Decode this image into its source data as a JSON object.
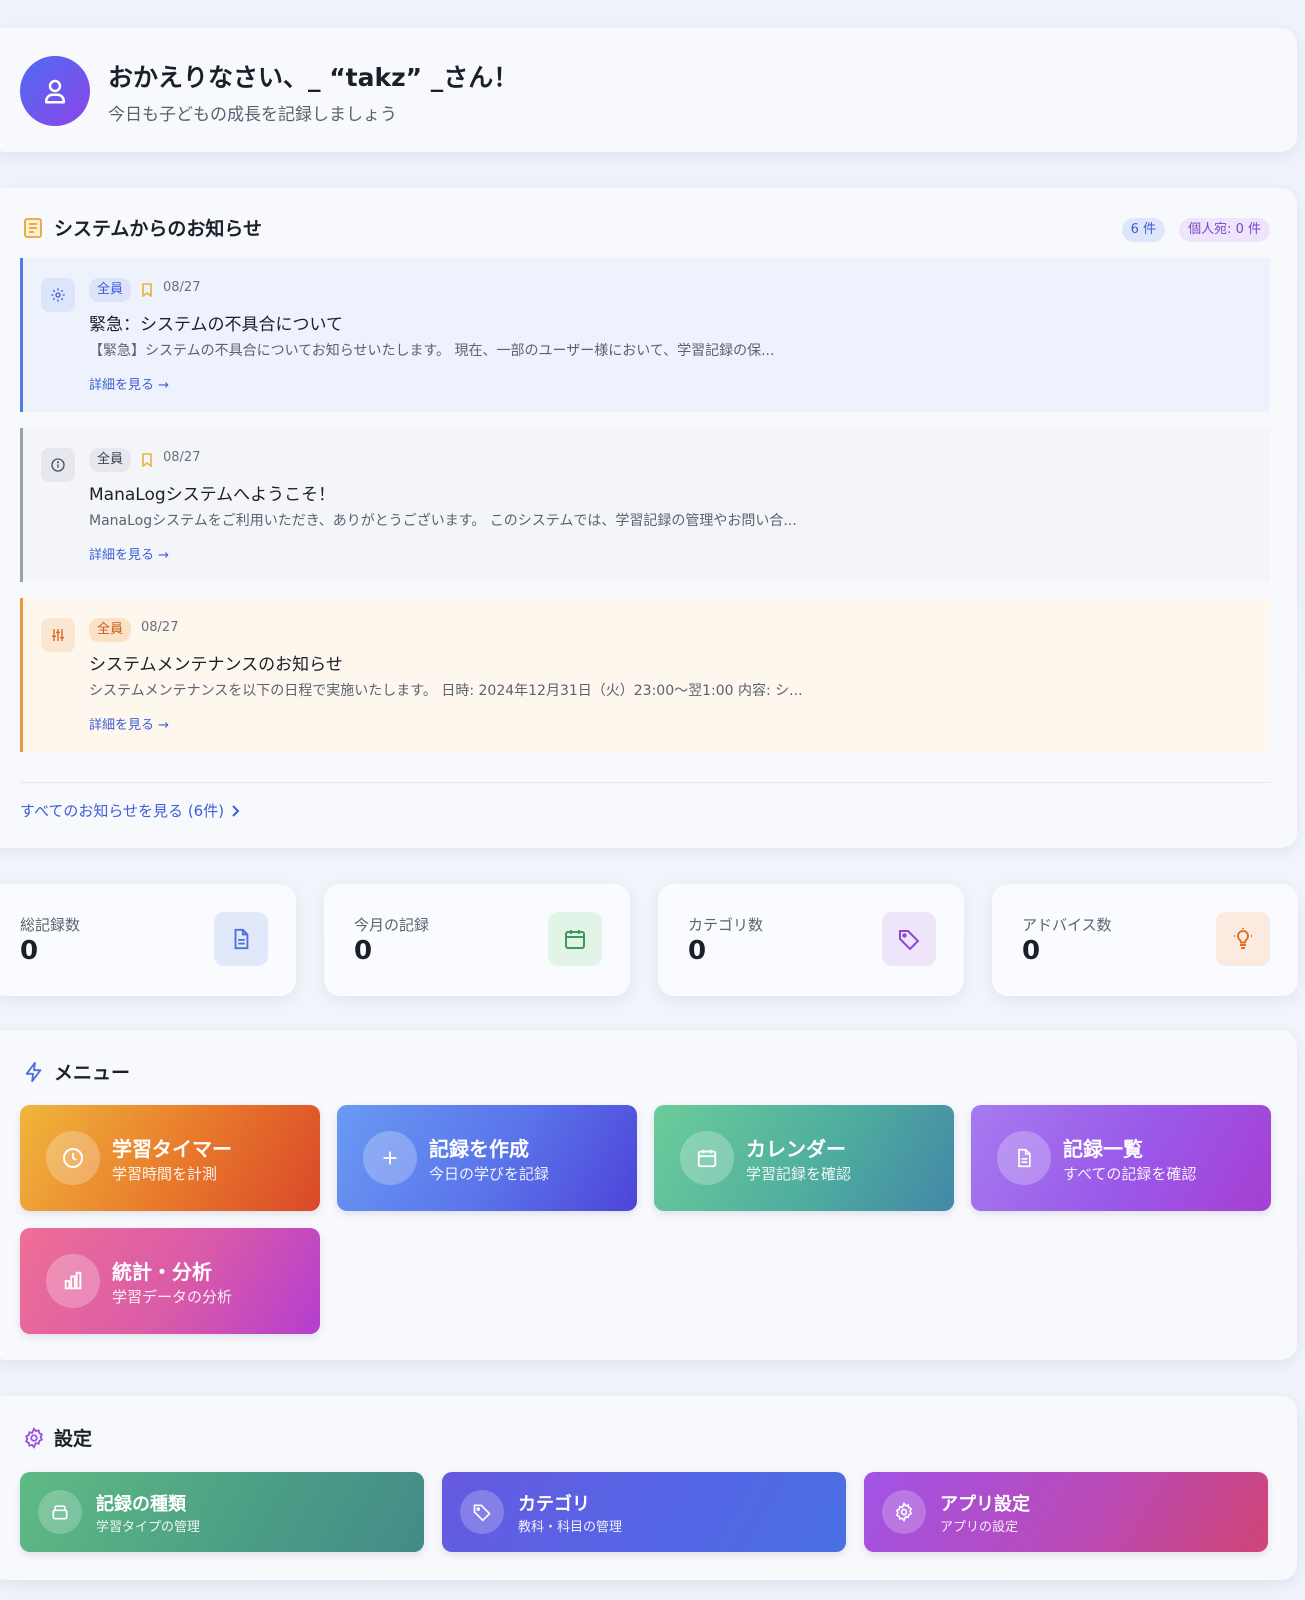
{
  "welcome": {
    "title": "おかえりなさい、_ “takz” _さん！",
    "subtitle": "今日も子どもの成長を記録しましょう",
    "avatar_icon": "user-icon"
  },
  "notices": {
    "title": "システムからのお知らせ",
    "count_badge": "6 件",
    "personal_badge": "個人宛: 0 件",
    "items": [
      {
        "icon": "gear-icon",
        "tag": "全員",
        "date": "08/27",
        "title": "緊急：システムの不具合について",
        "body": "【緊急】システムの不具合についてお知らせいたします。 現在、一部のユーザー様において、学習記録の保...",
        "link": "詳細を見る →",
        "accent": "#4f7be8"
      },
      {
        "icon": "info-icon",
        "tag": "全員",
        "date": "08/27",
        "title": "ManaLogシステムへようこそ！",
        "body": "ManaLogシステムをご利用いただき、ありがとうございます。 このシステムでは、学習記録の管理やお問い合...",
        "link": "詳細を見る →",
        "accent": "#9aa0ac"
      },
      {
        "icon": "sliders-icon",
        "tag": "全員",
        "date": "08/27",
        "title": "システムメンテナンスのお知らせ",
        "body": "システムメンテナンスを以下の日程で実施いたします。 日時: 2024年12月31日（火）23:00〜翌1:00 内容: シ...",
        "link": "詳細を見る →",
        "accent": "#ea9a3e"
      }
    ],
    "all_link": "すべてのお知らせを見る (6件)"
  },
  "stats": [
    {
      "label": "総記録数",
      "value": "0",
      "icon": "document-icon"
    },
    {
      "label": "今月の記録",
      "value": "0",
      "icon": "calendar-icon"
    },
    {
      "label": "カテゴリ数",
      "value": "0",
      "icon": "tag-icon"
    },
    {
      "label": "アドバイス数",
      "value": "0",
      "icon": "lightbulb-icon"
    }
  ],
  "menu": {
    "title": "メニュー",
    "items": [
      {
        "title": "学習タイマー",
        "subtitle": "学習時間を計測",
        "icon": "clock-icon"
      },
      {
        "title": "記録を作成",
        "subtitle": "今日の学びを記録",
        "icon": "plus-icon"
      },
      {
        "title": "カレンダー",
        "subtitle": "学習記録を確認",
        "icon": "calendar-icon"
      },
      {
        "title": "記録一覧",
        "subtitle": "すべての記録を確認",
        "icon": "document-icon"
      },
      {
        "title": "統計・分析",
        "subtitle": "学習データの分析",
        "icon": "bar-chart-icon"
      }
    ]
  },
  "settings": {
    "title": "設定",
    "items": [
      {
        "title": "記録の種類",
        "subtitle": "学習タイプの管理",
        "icon": "stack-icon"
      },
      {
        "title": "カテゴリ",
        "subtitle": "教科・科目の管理",
        "icon": "tag-icon"
      },
      {
        "title": "アプリ設定",
        "subtitle": "アプリの設定",
        "icon": "gear-icon"
      }
    ]
  }
}
